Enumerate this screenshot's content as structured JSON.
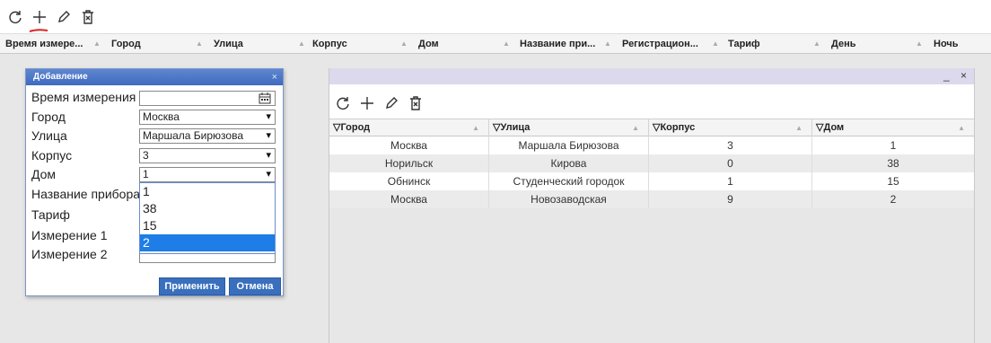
{
  "toolbar": {
    "icons": [
      "refresh-icon",
      "plus-icon",
      "pencil-icon",
      "trash-icon"
    ]
  },
  "main_header": {
    "columns": [
      "Время измере...",
      "Город",
      "Улица",
      "Корпус",
      "Дом",
      "Название при...",
      "Регистрацион...",
      "Тариф",
      "День",
      "Ночь"
    ]
  },
  "dialog": {
    "title": "Добавление",
    "close": "×",
    "labels": [
      "Время измерения",
      "Город",
      "Улица",
      "Корпус",
      "Дом",
      "Название прибора",
      "Тариф",
      "Измерение 1",
      "Измерение 2"
    ],
    "fields": {
      "time": "",
      "city": "Москва",
      "street": "Маршала Бирюзова",
      "building": "3",
      "house": "1"
    },
    "dropdown_options": [
      "1",
      "38",
      "15",
      "2"
    ],
    "dropdown_selected_index": 3,
    "apply_label": "Применить",
    "cancel_label": "Отмена"
  },
  "window": {
    "minimize": "_",
    "close": "×",
    "columns": [
      "Город",
      "Улица",
      "Корпус",
      "Дом"
    ],
    "filter_glyph": "▽",
    "rows": [
      [
        "Москва",
        "Маршала Бирюзова",
        "3",
        "1"
      ],
      [
        "Норильск",
        "Кирова",
        "0",
        "38"
      ],
      [
        "Обнинск",
        "Студенческий городок",
        "1",
        "15"
      ],
      [
        "Москва",
        "Новозаводская",
        "9",
        "2"
      ]
    ]
  },
  "colors": {
    "accent": "#3a6fbd",
    "selection": "#1e7de6",
    "annotation": "#e02020"
  }
}
